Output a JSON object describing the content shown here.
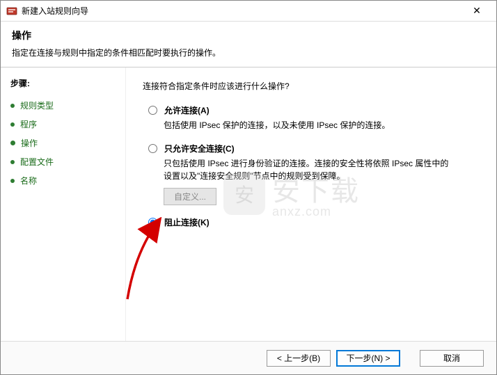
{
  "window": {
    "title": "新建入站规则向导",
    "close_symbol": "✕"
  },
  "header": {
    "title": "操作",
    "subtitle": "指定在连接与规则中指定的条件相匹配时要执行的操作。"
  },
  "sidebar": {
    "title": "步骤:",
    "items": [
      {
        "label": "规则类型"
      },
      {
        "label": "程序"
      },
      {
        "label": "操作",
        "current": true
      },
      {
        "label": "配置文件"
      },
      {
        "label": "名称"
      }
    ]
  },
  "main": {
    "prompt": "连接符合指定条件时应该进行什么操作?",
    "options": {
      "allow": {
        "label": "允许连接(A)",
        "desc": "包括使用 IPsec 保护的连接，以及未使用 IPsec 保护的连接。"
      },
      "secure": {
        "label": "只允许安全连接(C)",
        "desc": "只包括使用 IPsec 进行身份验证的连接。连接的安全性将依照 IPsec 属性中的设置以及\"连接安全规则\"节点中的规则受到保障。",
        "custom_btn": "自定义..."
      },
      "block": {
        "label": "阻止连接(K)"
      },
      "selected": "block"
    }
  },
  "footer": {
    "back": "< 上一步(B)",
    "next": "下一步(N) >",
    "cancel": "取消"
  },
  "watermark": {
    "main": "安下载",
    "sub": "anxz.com",
    "badge": "安"
  }
}
